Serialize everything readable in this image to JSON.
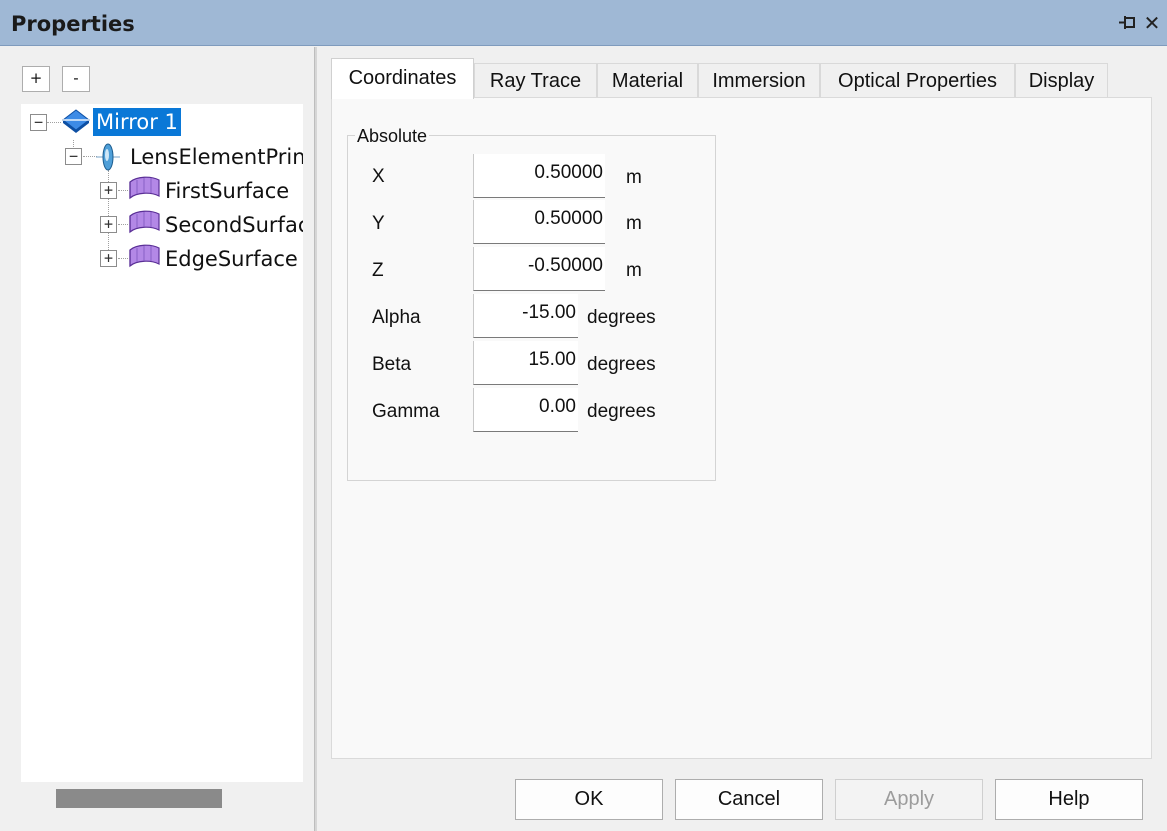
{
  "window": {
    "title": "Properties",
    "pin_glyph": "⊣",
    "close_glyph": "✕"
  },
  "toolbar": {
    "expand_label": "+",
    "collapse_label": "-"
  },
  "tree": {
    "expander_open": "−",
    "expander_closed": "+",
    "nodes": [
      {
        "label": "Mirror 1",
        "icon": "mirror-icon",
        "expanded": true,
        "selected": true
      },
      {
        "label": "LensElementPrin",
        "icon": "lens-element-icon",
        "expanded": true
      },
      {
        "label": "FirstSurface",
        "icon": "surface-icon",
        "expanded": false
      },
      {
        "label": "SecondSurfac",
        "icon": "surface-icon",
        "expanded": false
      },
      {
        "label": "EdgeSurface",
        "icon": "surface-icon",
        "expanded": false
      }
    ]
  },
  "tabs": [
    {
      "label": "Coordinates",
      "active": true
    },
    {
      "label": "Ray Trace"
    },
    {
      "label": "Material"
    },
    {
      "label": "Immersion"
    },
    {
      "label": "Optical Properties"
    },
    {
      "label": "Display"
    }
  ],
  "coordinates": {
    "group_title": "Absolute",
    "fields": [
      {
        "label": "X",
        "value": "0.50000",
        "unit": "m"
      },
      {
        "label": "Y",
        "value": "0.50000",
        "unit": "m"
      },
      {
        "label": "Z",
        "value": "-0.50000",
        "unit": "m"
      },
      {
        "label": "Alpha",
        "value": "-15.00",
        "unit": "degrees"
      },
      {
        "label": "Beta",
        "value": "15.00",
        "unit": "degrees"
      },
      {
        "label": "Gamma",
        "value": "0.00",
        "unit": "degrees"
      }
    ]
  },
  "buttons": {
    "ok": {
      "label": "OK"
    },
    "cancel": {
      "label": "Cancel"
    },
    "apply": {
      "label": "Apply",
      "enabled": false
    },
    "help": {
      "label": "Help"
    }
  },
  "colors": {
    "titlebar": "#9fb8d5",
    "selection": "#0a78d7",
    "surface_icon": "#b388e6",
    "mirror_icon": "#1e6fd0"
  }
}
